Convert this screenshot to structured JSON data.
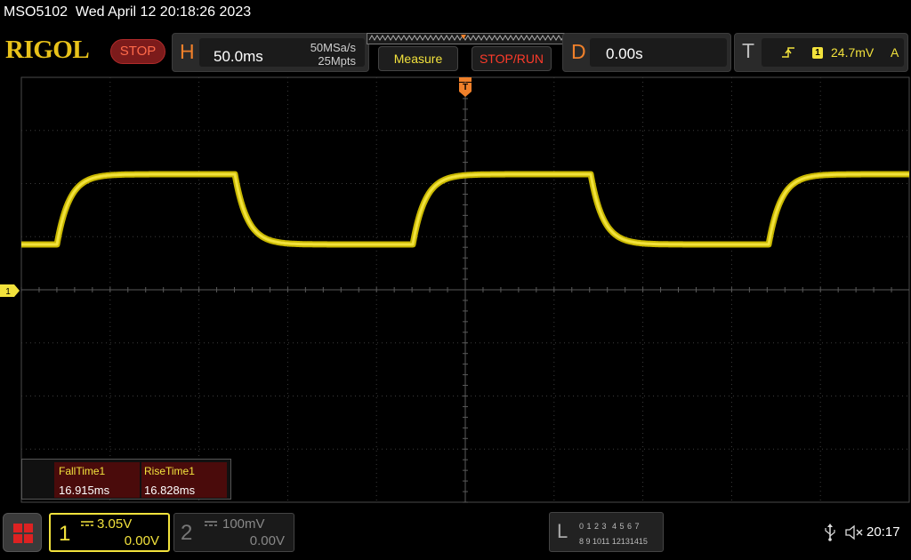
{
  "title_bar": {
    "text": "MSO5102  Wed April 12 20:18:26 2023"
  },
  "brand": {
    "logo": "RIGOL"
  },
  "run_status": "STOP",
  "horizontal": {
    "letter": "H",
    "time_per_div": "50.0ms",
    "sample_rate": "50MSa/s",
    "memory_depth": "25Mpts"
  },
  "buttons": {
    "measure": "Measure",
    "stop_run": "STOP/RUN"
  },
  "delay": {
    "letter": "D",
    "value": "0.00s"
  },
  "trigger": {
    "letter": "T",
    "edge_icon": "rising-edge-icon",
    "channel": "1",
    "level": "24.7mV",
    "mode": "A"
  },
  "markers": {
    "trigger_position": "T",
    "ch1_offset": "1"
  },
  "measurements": {
    "headers": [
      "FallTime1",
      "RiseTime1"
    ],
    "values": [
      "16.915ms",
      "16.828ms"
    ]
  },
  "channels": [
    {
      "number": "1",
      "scale": "3.05V",
      "offset": "0.00V",
      "active": true,
      "color": "#f2e23c"
    },
    {
      "number": "2",
      "scale": "100mV",
      "offset": "0.00V",
      "active": false,
      "color": "#888888"
    }
  ],
  "logic_analyzer": {
    "letter": "L",
    "row1": "0 1 2 3  4 5 6 7",
    "row2": "8 9 1011 12131415"
  },
  "status_icons": [
    "usb-icon",
    "speaker-muted-icon"
  ],
  "clock": "20:17",
  "colors": {
    "accent": "#f0802a",
    "channel1": "#f2e23c",
    "stop": "#ff3b2a"
  }
}
